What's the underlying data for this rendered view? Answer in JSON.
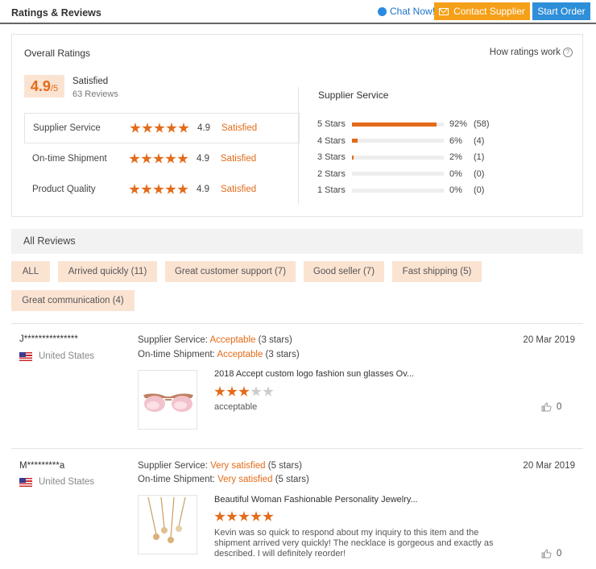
{
  "header": {
    "title": "Ratings & Reviews",
    "chat_label": "Chat Now!",
    "contact_label": "Contact Supplier",
    "order_label": "Start Order"
  },
  "overall": {
    "title": "Overall Ratings",
    "how_label": "How ratings work",
    "score": "4.9",
    "score_suffix": "/5",
    "satisfied": "Satisfied",
    "reviews_count": "63 Reviews",
    "metrics": [
      {
        "label": "Supplier Service",
        "value": "4.9",
        "status": "Satisfied",
        "stars": 5
      },
      {
        "label": "On-time Shipment",
        "value": "4.9",
        "status": "Satisfied",
        "stars": 5
      },
      {
        "label": "Product Quality",
        "value": "4.9",
        "status": "Satisfied",
        "stars": 5
      }
    ],
    "supplier_service_title": "Supplier Service",
    "distribution": [
      {
        "label": "5 Stars",
        "percent": "92%",
        "count": "(58)",
        "fraction": 0.92
      },
      {
        "label": "4 Stars",
        "percent": "6%",
        "count": "(4)",
        "fraction": 0.06
      },
      {
        "label": "3 Stars",
        "percent": "2%",
        "count": "(1)",
        "fraction": 0.02
      },
      {
        "label": "2 Stars",
        "percent": "0%",
        "count": "(0)",
        "fraction": 0.0
      },
      {
        "label": "1 Stars",
        "percent": "0%",
        "count": "(0)",
        "fraction": 0.0
      }
    ]
  },
  "all_reviews": {
    "title": "All Reviews",
    "filters": [
      "ALL",
      "Arrived quickly (11)",
      "Great customer support (7)",
      "Good seller (7)",
      "Fast shipping (5)",
      "Great communication (4)"
    ]
  },
  "reviews": [
    {
      "name": "J***************",
      "country": "United States",
      "supplier_label": "Supplier Service:",
      "supplier_value": "Acceptable",
      "supplier_stars": "(3 stars)",
      "shipment_label": "On-time Shipment:",
      "shipment_value": "Acceptable",
      "shipment_stars": "(3 stars)",
      "date": "20 Mar 2019",
      "product_title": "2018 Accept custom logo fashion sun glasses Ov...",
      "rating": 3,
      "text": "acceptable",
      "likes": "0"
    },
    {
      "name": "M*********a",
      "country": "United States",
      "supplier_label": "Supplier Service:",
      "supplier_value": "Very satisfied",
      "supplier_stars": "(5 stars)",
      "shipment_label": "On-time Shipment:",
      "shipment_value": "Very satisfied",
      "shipment_stars": "(5 stars)",
      "date": "20 Mar 2019",
      "product_title": "Beautiful Woman Fashionable Personality Jewelry...",
      "rating": 5,
      "text": "Kevin was so quick to respond about my inquiry to this item and the shipment arrived very quickly! The necklace is gorgeous and exactly as described. I will definitely reorder!",
      "likes": "0"
    }
  ],
  "colors": {
    "accent": "#e36b19",
    "accent_light": "#fbe3d2",
    "contact_btn": "#f5a019",
    "order_btn": "#2e8ed8"
  }
}
